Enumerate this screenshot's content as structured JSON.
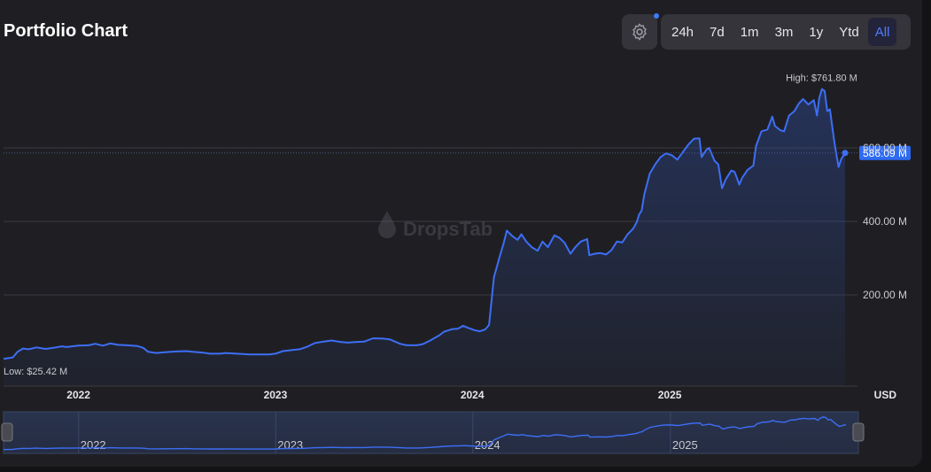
{
  "header": {
    "title": "Portfolio Chart",
    "ranges": [
      "24h",
      "7d",
      "1m",
      "3m",
      "1y",
      "Ytd",
      "All"
    ],
    "active_range": "All"
  },
  "colors": {
    "line": "#3d6ef5",
    "grid": "#3a3a40",
    "text_muted": "#c9c9cf",
    "badge_bg": "#2f6bf2"
  },
  "watermark": "DropsTab",
  "navigator_labels": [
    "2022",
    "2023",
    "2024",
    "2025"
  ],
  "chart_data": {
    "type": "area",
    "title": "Portfolio Chart",
    "currency_label": "USD",
    "x_ticks": [
      "2022",
      "2023",
      "2024",
      "2025"
    ],
    "y_ticks": [
      200,
      400,
      600
    ],
    "y_tick_labels": [
      "200.00 M",
      "400.00 M",
      "600.00 M"
    ],
    "ylim": [
      0,
      800
    ],
    "xlim": [
      "2021-08-15",
      "2025-12-15"
    ],
    "grid": true,
    "unit": "M",
    "high_label": "High: $761.80 M",
    "low_label": "Low: $25.42 M",
    "current_label": "586.09 M",
    "current_value": 586.09,
    "series": [
      {
        "values": [
          [
            "2021-08-15",
            26
          ],
          [
            "2021-09-01",
            30
          ],
          [
            "2021-09-10",
            45
          ],
          [
            "2021-09-20",
            54
          ],
          [
            "2021-10-01",
            52
          ],
          [
            "2021-10-15",
            57
          ],
          [
            "2021-11-01",
            53
          ],
          [
            "2021-11-15",
            56
          ],
          [
            "2021-12-01",
            60
          ],
          [
            "2021-12-10",
            58
          ],
          [
            "2022-01-01",
            62
          ],
          [
            "2022-01-20",
            63
          ],
          [
            "2022-02-01",
            67
          ],
          [
            "2022-02-15",
            62
          ],
          [
            "2022-03-01",
            68
          ],
          [
            "2022-03-15",
            64
          ],
          [
            "2022-04-01",
            63
          ],
          [
            "2022-04-20",
            61
          ],
          [
            "2022-05-01",
            56
          ],
          [
            "2022-05-10",
            45
          ],
          [
            "2022-05-25",
            42
          ],
          [
            "2022-06-10",
            44
          ],
          [
            "2022-07-01",
            46
          ],
          [
            "2022-07-20",
            47
          ],
          [
            "2022-08-01",
            45
          ],
          [
            "2022-08-20",
            43
          ],
          [
            "2022-09-01",
            40
          ],
          [
            "2022-09-20",
            40
          ],
          [
            "2022-10-01",
            42
          ],
          [
            "2022-10-20",
            40
          ],
          [
            "2022-11-01",
            39
          ],
          [
            "2022-11-15",
            38
          ],
          [
            "2022-12-01",
            38
          ],
          [
            "2022-12-20",
            38
          ],
          [
            "2023-01-01",
            40
          ],
          [
            "2023-01-15",
            47
          ],
          [
            "2023-02-01",
            50
          ],
          [
            "2023-02-15",
            52
          ],
          [
            "2023-03-01",
            59
          ],
          [
            "2023-03-15",
            69
          ],
          [
            "2023-04-01",
            73
          ],
          [
            "2023-04-15",
            76
          ],
          [
            "2023-05-01",
            72
          ],
          [
            "2023-05-15",
            70
          ],
          [
            "2023-06-01",
            72
          ],
          [
            "2023-06-15",
            73
          ],
          [
            "2023-07-01",
            82
          ],
          [
            "2023-07-20",
            81
          ],
          [
            "2023-08-01",
            79
          ],
          [
            "2023-08-20",
            67
          ],
          [
            "2023-09-01",
            63
          ],
          [
            "2023-09-20",
            63
          ],
          [
            "2023-10-01",
            66
          ],
          [
            "2023-10-15",
            76
          ],
          [
            "2023-11-01",
            90
          ],
          [
            "2023-11-10",
            100
          ],
          [
            "2023-11-25",
            107
          ],
          [
            "2023-12-05",
            108
          ],
          [
            "2023-12-15",
            116
          ],
          [
            "2023-12-25",
            110
          ],
          [
            "2024-01-05",
            104
          ],
          [
            "2024-01-15",
            101
          ],
          [
            "2024-01-25",
            106
          ],
          [
            "2024-02-01",
            118
          ],
          [
            "2024-02-10",
            248
          ],
          [
            "2024-02-20",
            300
          ],
          [
            "2024-02-28",
            340
          ],
          [
            "2024-03-05",
            375
          ],
          [
            "2024-03-15",
            360
          ],
          [
            "2024-03-25",
            350
          ],
          [
            "2024-04-01",
            365
          ],
          [
            "2024-04-10",
            345
          ],
          [
            "2024-04-20",
            330
          ],
          [
            "2024-05-01",
            320
          ],
          [
            "2024-05-10",
            345
          ],
          [
            "2024-05-20",
            330
          ],
          [
            "2024-06-01",
            362
          ],
          [
            "2024-06-10",
            356
          ],
          [
            "2024-06-20",
            342
          ],
          [
            "2024-07-01",
            312
          ],
          [
            "2024-07-10",
            330
          ],
          [
            "2024-07-20",
            345
          ],
          [
            "2024-08-01",
            352
          ],
          [
            "2024-08-05",
            308
          ],
          [
            "2024-08-15",
            312
          ],
          [
            "2024-08-25",
            314
          ],
          [
            "2024-09-05",
            310
          ],
          [
            "2024-09-15",
            322
          ],
          [
            "2024-09-25",
            345
          ],
          [
            "2024-10-05",
            343
          ],
          [
            "2024-10-15",
            365
          ],
          [
            "2024-10-25",
            380
          ],
          [
            "2024-11-01",
            398
          ],
          [
            "2024-11-05",
            418
          ],
          [
            "2024-11-10",
            430
          ],
          [
            "2024-11-15",
            475
          ],
          [
            "2024-11-25",
            530
          ],
          [
            "2024-12-05",
            555
          ],
          [
            "2024-12-15",
            575
          ],
          [
            "2024-12-25",
            585
          ],
          [
            "2025-01-05",
            580
          ],
          [
            "2025-01-15",
            568
          ],
          [
            "2025-01-25",
            588
          ],
          [
            "2025-02-05",
            610
          ],
          [
            "2025-02-15",
            625
          ],
          [
            "2025-02-25",
            626
          ],
          [
            "2025-03-01",
            575
          ],
          [
            "2025-03-10",
            595
          ],
          [
            "2025-03-15",
            600
          ],
          [
            "2025-03-25",
            565
          ],
          [
            "2025-04-01",
            555
          ],
          [
            "2025-04-08",
            490
          ],
          [
            "2025-04-15",
            515
          ],
          [
            "2025-04-25",
            538
          ],
          [
            "2025-05-01",
            535
          ],
          [
            "2025-05-05",
            520
          ],
          [
            "2025-05-10",
            500
          ],
          [
            "2025-05-15",
            518
          ],
          [
            "2025-05-25",
            540
          ],
          [
            "2025-06-05",
            552
          ],
          [
            "2025-06-10",
            605
          ],
          [
            "2025-06-20",
            645
          ],
          [
            "2025-07-01",
            650
          ],
          [
            "2025-07-10",
            685
          ],
          [
            "2025-07-15",
            660
          ],
          [
            "2025-07-25",
            648
          ],
          [
            "2025-08-01",
            645
          ],
          [
            "2025-08-10",
            688
          ],
          [
            "2025-08-20",
            700
          ],
          [
            "2025-08-28",
            720
          ],
          [
            "2025-09-05",
            733
          ],
          [
            "2025-09-15",
            718
          ],
          [
            "2025-09-25",
            730
          ],
          [
            "2025-10-01",
            688
          ],
          [
            "2025-10-05",
            735
          ],
          [
            "2025-10-10",
            760
          ],
          [
            "2025-10-15",
            755
          ],
          [
            "2025-10-20",
            700
          ],
          [
            "2025-10-25",
            705
          ],
          [
            "2025-11-01",
            628
          ],
          [
            "2025-11-05",
            590
          ],
          [
            "2025-11-10",
            548
          ],
          [
            "2025-11-15",
            570
          ],
          [
            "2025-11-22",
            586
          ]
        ]
      }
    ]
  }
}
